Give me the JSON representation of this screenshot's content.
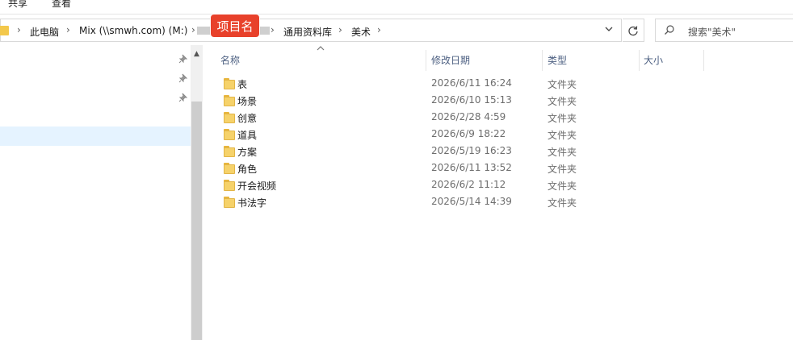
{
  "ribbon": {
    "tabs": [
      {
        "label": "共享"
      },
      {
        "label": "查看"
      }
    ]
  },
  "address": {
    "crumbs": [
      {
        "label": "此电脑"
      },
      {
        "label": "Mix (\\\\smwh.com) (M:)"
      },
      {
        "label": "通用资料库"
      },
      {
        "label": "美术"
      }
    ],
    "badge_label": "项目名",
    "dropdown_icon": "chevron-down-icon",
    "refresh_icon": "refresh-icon"
  },
  "search": {
    "placeholder": "搜索\"美术\""
  },
  "columns": {
    "name": "名称",
    "date": "修改日期",
    "type": "类型",
    "size": "大小"
  },
  "files": [
    {
      "name": "表",
      "date": "2026/6/11 16:24",
      "type": "文件夹"
    },
    {
      "name": "场景",
      "date": "2026/6/10 15:13",
      "type": "文件夹"
    },
    {
      "name": "创意",
      "date": "2026/2/28 4:59",
      "type": "文件夹"
    },
    {
      "name": "道具",
      "date": "2026/6/9 18:22",
      "type": "文件夹"
    },
    {
      "name": "方案",
      "date": "2026/5/19 16:23",
      "type": "文件夹"
    },
    {
      "name": "角色",
      "date": "2026/6/11 13:52",
      "type": "文件夹"
    },
    {
      "name": "开会视频",
      "date": "2026/6/2 11:12",
      "type": "文件夹"
    },
    {
      "name": "书法字",
      "date": "2026/5/14 14:39",
      "type": "文件夹"
    }
  ],
  "colors": {
    "badge": "#e8412b",
    "folder": "#f6d26a",
    "selection": "#e5f3ff",
    "header_text": "#4d6082"
  }
}
